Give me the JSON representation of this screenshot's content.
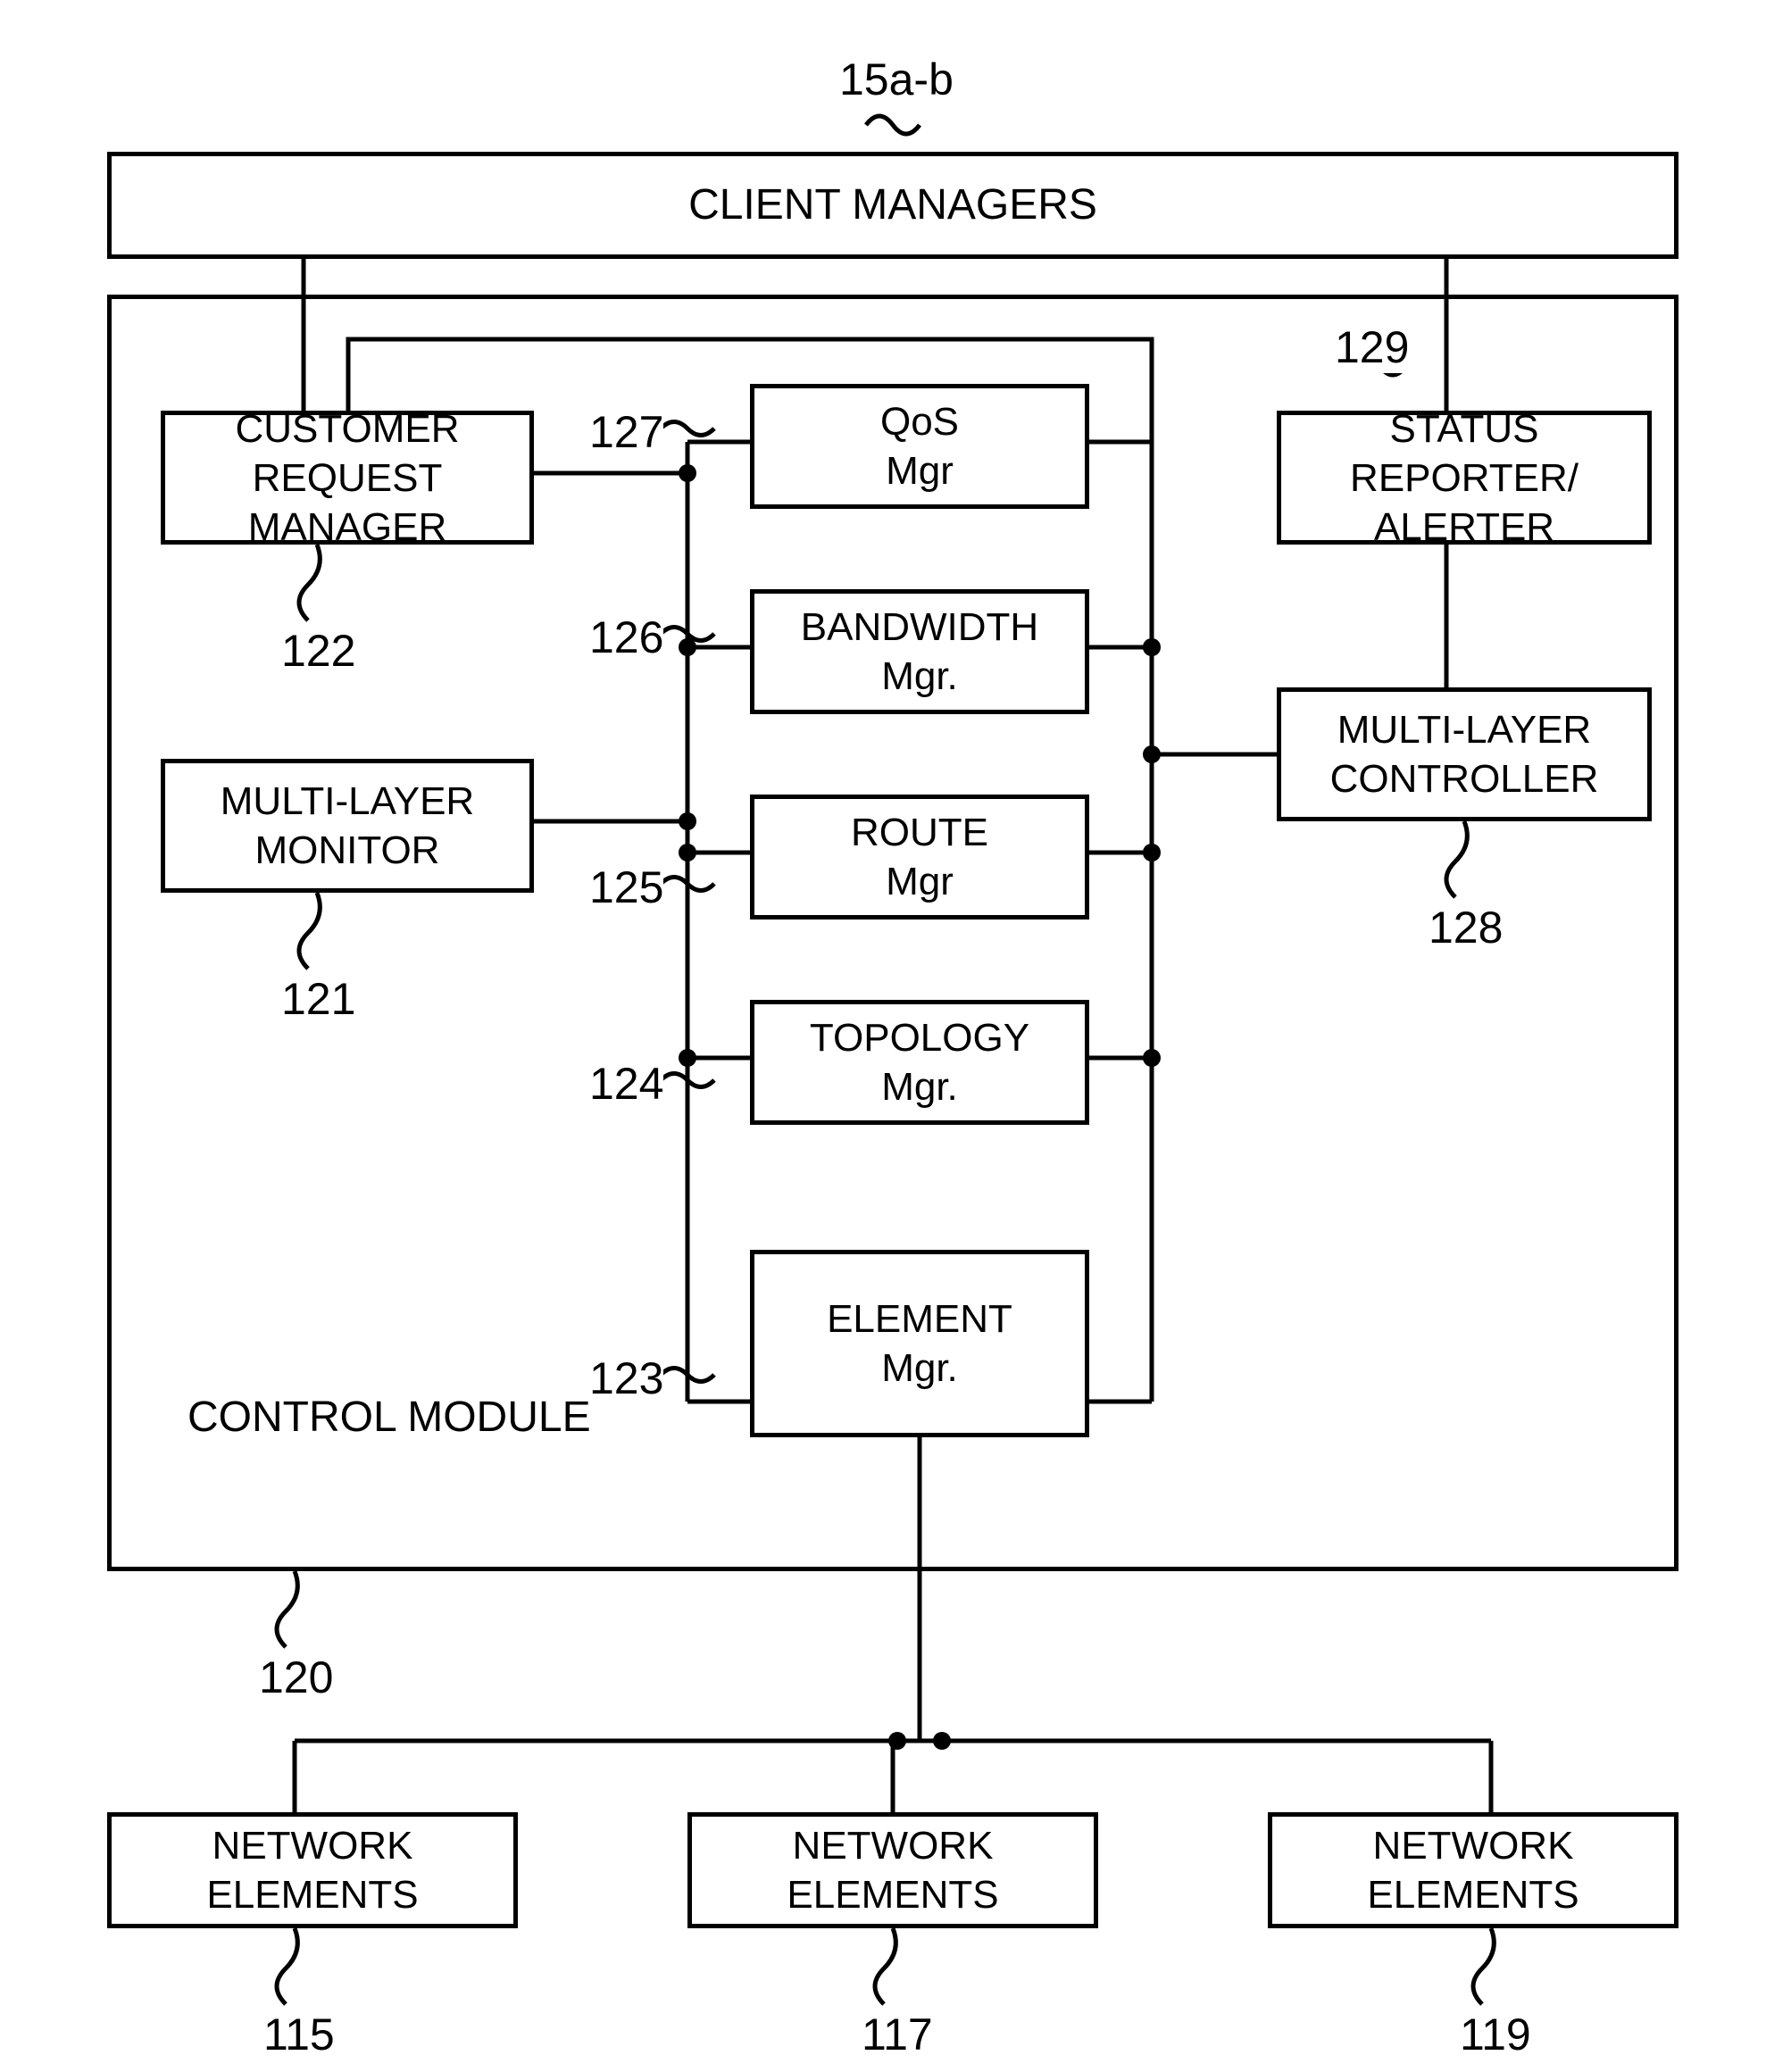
{
  "topLabel": "15a-b",
  "clientManagers": "CLIENT MANAGERS",
  "controlModule": "CONTROL MODULE",
  "crm": {
    "text": "CUSTOMER\nREQUEST MANAGER",
    "ref": "122"
  },
  "mlm": {
    "text": "MULTI-LAYER\nMONITOR",
    "ref": "121"
  },
  "qos": {
    "text": "QoS\nMgr",
    "ref": "127"
  },
  "band": {
    "text": "BANDWIDTH\nMgr.",
    "ref": "126"
  },
  "route": {
    "text": "ROUTE\nMgr",
    "ref": "125"
  },
  "topo": {
    "text": "TOPOLOGY\nMgr.",
    "ref": "124"
  },
  "elem": {
    "text": "ELEMENT\nMgr.",
    "ref": "123"
  },
  "status": {
    "text": "STATUS REPORTER/\nALERTER",
    "ref": "129"
  },
  "mlc": {
    "text": "MULTI-LAYER\nCONTROLLER",
    "ref": "128"
  },
  "ne1": {
    "text": "NETWORK ELEMENTS",
    "ref": "115"
  },
  "ne2": {
    "text": "NETWORK ELEMENTS",
    "ref": "117"
  },
  "ne3": {
    "text": "NETWORK ELEMENTS",
    "ref": "119"
  },
  "controlModuleRef": "120"
}
